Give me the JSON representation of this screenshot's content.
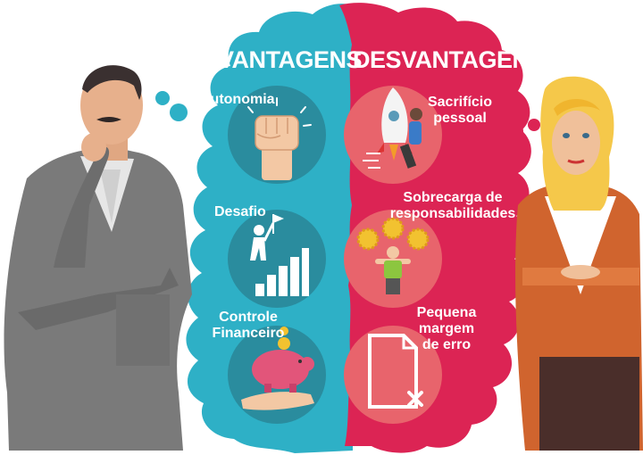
{
  "headers": {
    "advantages": "VANTAGENS",
    "disadvantages": "DESVANTAGENS"
  },
  "advantages": [
    {
      "label": "Autonomia",
      "icon": "raised-fist-icon"
    },
    {
      "label": "Desafio",
      "icon": "climbing-stairs-flag-icon"
    },
    {
      "label_line1": "Controle",
      "label_line2": "Financeiro",
      "icon": "piggy-bank-hand-icon"
    }
  ],
  "disadvantages": [
    {
      "label_line1": "Sacrifício",
      "label_line2": "pessoal",
      "icon": "man-pushing-rocket-icon"
    },
    {
      "label_line1": "Sobrecarga de",
      "label_line2": "responsabilidades",
      "icon": "man-lifting-gears-icon"
    },
    {
      "label_line1": "Pequena",
      "label_line2": "margem",
      "label_line3": "de erro",
      "icon": "document-error-icon"
    }
  ],
  "colors": {
    "advantages_cloud": "#2eb0c6",
    "disadvantages_cloud": "#dc2454",
    "advantage_circle": "#2a8c9e",
    "disadvantage_circle": "#e8646c",
    "man_suit": "#7a7a7a",
    "woman_blazer": "#d0642e",
    "woman_hair": "#f5c84a"
  }
}
